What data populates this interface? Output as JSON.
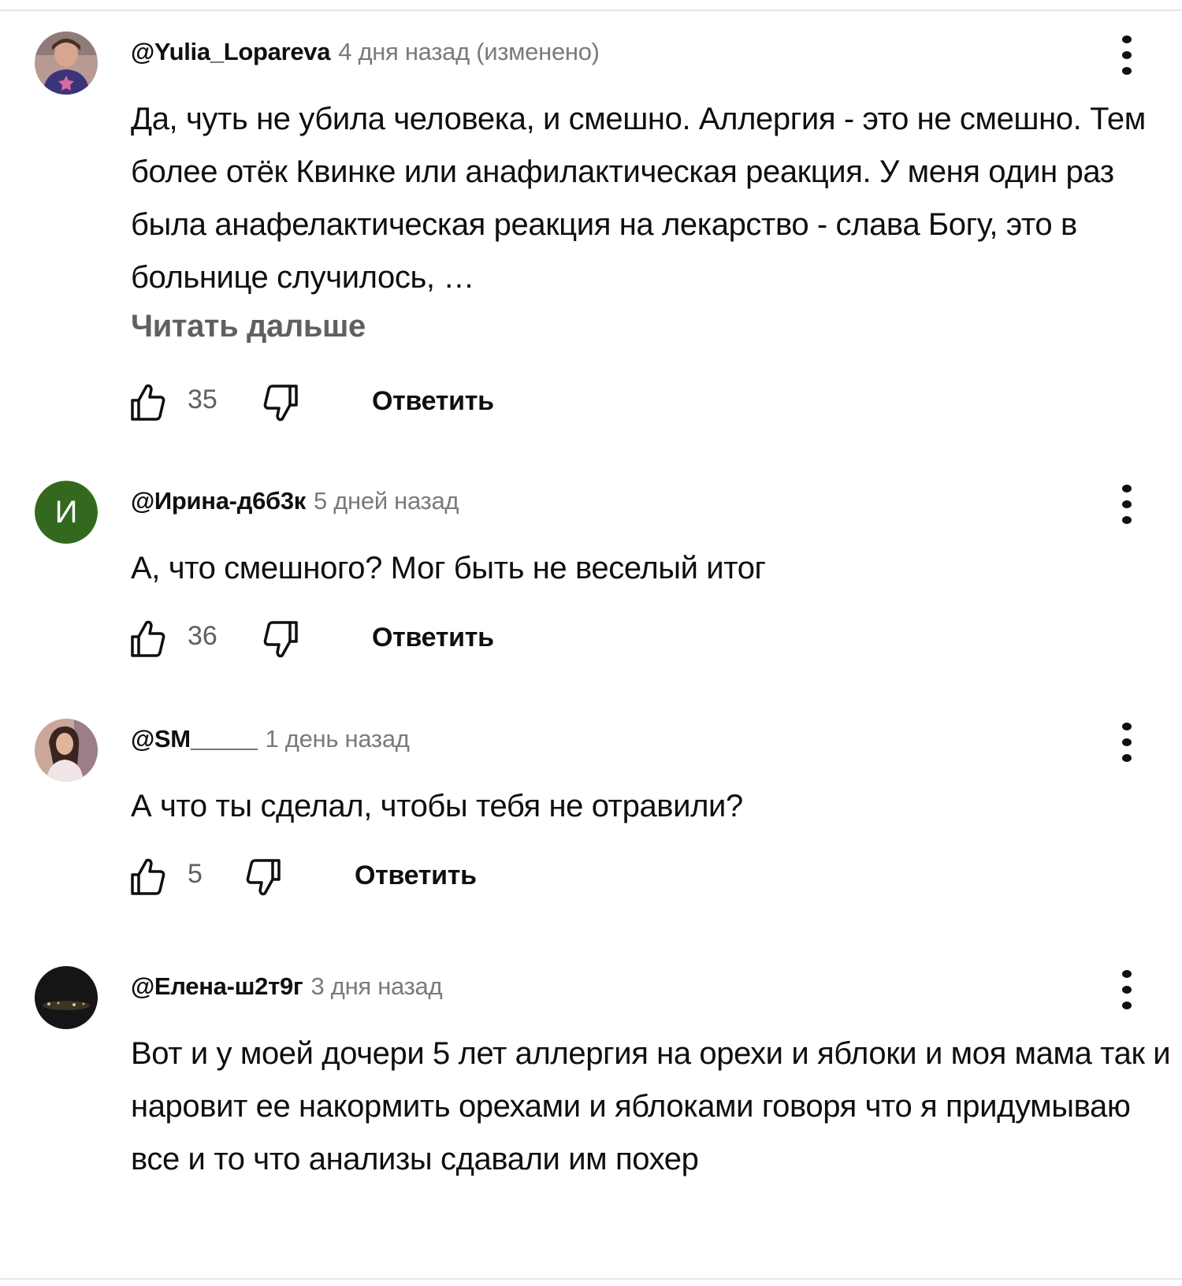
{
  "comments": [
    {
      "author": "@Yulia_Lopareva",
      "time": "4 дня назад (изменено)",
      "text": "Да, чуть не убила человека, и смешно. Аллергия - это не смешно. Тем более отёк Квинке или анафилактическая реакция. У меня один раз была анафелактическая реакция на лекарство - слава Богу, это в больнице случилось, …",
      "read_more": "Читать дальше",
      "likes": "35",
      "reply_label": "Ответить"
    },
    {
      "author": "@Ирина-д6б3к",
      "avatar_letter": "И",
      "time": "5 дней назад",
      "text": "А, что смешного? Мог быть не веселый итог",
      "likes": "36",
      "reply_label": "Ответить"
    },
    {
      "author": "@SM_____",
      "time": "1 день назад",
      "text": "А что ты сделал, чтобы тебя не отравили?",
      "likes": "5",
      "reply_label": "Ответить"
    },
    {
      "author": "@Елена-ш2т9г",
      "time": "3 дня назад",
      "text": "Вот и у моей дочери 5 лет аллергия на орехи и яблоки и моя мама так и наровит ее накормить орехами и яблоками говоря что я придумываю все и то что анализы сдавали им похер"
    }
  ],
  "icons": {
    "like": "thumb-up-outline-icon",
    "dislike": "thumb-down-outline-icon",
    "menu": "more-vert-icon"
  },
  "colors": {
    "avatar_green": "#33691e",
    "secondary_text": "#606060",
    "timestamp": "#7a7a7a"
  }
}
